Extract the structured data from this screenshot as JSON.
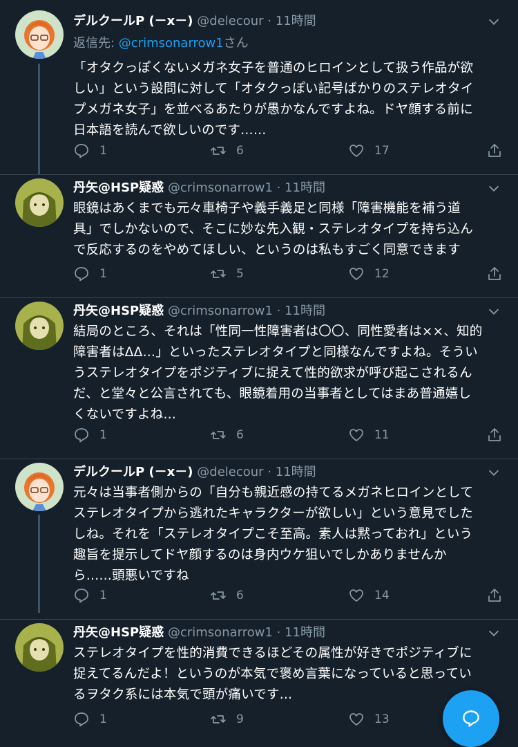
{
  "tweets": [
    {
      "author": "デルクールP (－x－)",
      "handle": "@delecour",
      "sep": "·",
      "time": "11時間",
      "reply_prefix": "返信先: ",
      "reply_handle": "@crimsonarrow1",
      "reply_suffix": "さん",
      "lines": [
        "「オタクっぽくないメガネ女子を普通のヒロインとして扱う作品が欲",
        "しい」という設問に対して「オタクっぽい記号ばかりのステレオタイ",
        "プメガネ女子」を並べるあたりが愚かなんですよね。ドヤ顔する前に",
        "日本語を読んで欲しいのです……"
      ],
      "replies": "1",
      "retweets": "6",
      "likes": "17"
    },
    {
      "author": "丹矢@HSP疑惑",
      "handle": "@crimsonarrow1",
      "sep": "·",
      "time": "11時間",
      "lines": [
        "眼鏡はあくまでも元々車椅子や義手義足と同様「障害機能を補う道",
        "具」でしかないので、そこに妙な先入観・ステレオタイプを持ち込ん",
        "で反応するのをやめてほしい、というのは私もすごく同意できます"
      ],
      "replies": "1",
      "retweets": "5",
      "likes": "12"
    },
    {
      "author": "丹矢@HSP疑惑",
      "handle": "@crimsonarrow1",
      "sep": "·",
      "time": "11時間",
      "lines": [
        "結局のところ、それは「性同一性障害者は〇〇、同性愛者は××、知的",
        "障害者はΔΔ…」といったステレオタイプと同様なんですよね。そうい",
        "うステレオタイプをポジティブに捉えて性的欲求が呼び起こされるん",
        "だ、と堂々と公言されても、眼鏡着用の当事者としてはまあ普通嬉し",
        "くないですよね…"
      ],
      "replies": "1",
      "retweets": "6",
      "likes": "11"
    },
    {
      "author": "デルクールP (－x－)",
      "handle": "@delecour",
      "sep": "·",
      "time": "11時間",
      "lines": [
        "元々は当事者側からの「自分も親近感の持てるメガネヒロインとして",
        "ステレオタイプから逃れたキャラクターが欲しい」という意見でした",
        "しね。それを「ステレオタイプこそ至高。素人は黙っておれ」という",
        "趣旨を提示してドヤ顔するのは身内ウケ狙いでしかありませんか",
        "ら……頭悪いですね"
      ],
      "replies": "1",
      "retweets": "6",
      "likes": "14"
    },
    {
      "author": "丹矢@HSP疑惑",
      "handle": "@crimsonarrow1",
      "sep": "·",
      "time": "11時間",
      "lines": [
        "ステレオタイプを性的消費できるほどその属性が好きでポジティブに",
        "捉えてるんだよ！というのが本気で褒め言葉になっていると思ってい",
        "るヲタク系には本気で頭が痛いです…"
      ],
      "replies": "1",
      "retweets": "9",
      "likes": "13"
    }
  ],
  "icons": {
    "reply": "reply-icon",
    "retweet": "retweet-icon",
    "like": "heart-icon",
    "share": "share-icon",
    "more": "chevron-down-icon",
    "compose": "compose-message-icon"
  },
  "colors": {
    "background": "#15202b",
    "accent": "#1da1f2",
    "muted": "#8899a6",
    "divider": "#38444d"
  }
}
